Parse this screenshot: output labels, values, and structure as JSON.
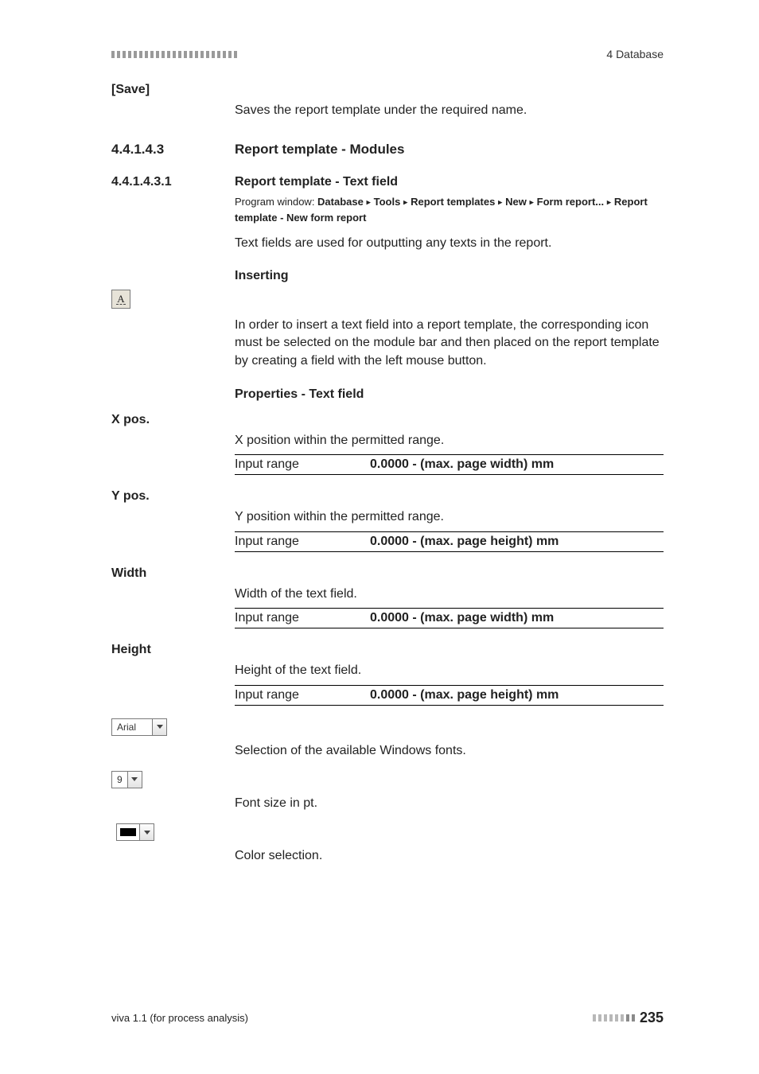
{
  "header": {
    "right": "4 Database"
  },
  "save": {
    "label": "[Save]",
    "desc": "Saves the report template under the required name."
  },
  "sec1": {
    "num": "4.4.1.4.3",
    "title": "Report template - Modules"
  },
  "sec2": {
    "num": "4.4.1.4.3.1",
    "title": "Report template - Text field",
    "crumb_prefix": "Program window: ",
    "crumb1": "Database",
    "crumb2": "Tools",
    "crumb3": "Report templates",
    "crumb4": "New",
    "crumb5": "Form report...",
    "crumb6": "Report template - New form report",
    "desc": "Text fields are used for outputting any texts in the report."
  },
  "inserting": {
    "title": "Inserting",
    "desc": "In order to insert a text field into a report template, the corresponding icon must be selected on the module bar and then placed on the report template by creating a field with the left mouse button."
  },
  "props": {
    "title": "Properties - Text field"
  },
  "xpos": {
    "label": "X pos.",
    "desc": "X position within the permitted range.",
    "range_label": "Input range",
    "range_value": "0.0000 - (max. page width) mm"
  },
  "ypos": {
    "label": "Y pos.",
    "desc": "Y position within the permitted range.",
    "range_label": "Input range",
    "range_value": "0.0000 - (max. page height) mm"
  },
  "width": {
    "label": "Width",
    "desc": "Width of the text field.",
    "range_label": "Input range",
    "range_value": "0.0000 - (max. page width) mm"
  },
  "height": {
    "label": "Height",
    "desc": "Height of the text field.",
    "range_label": "Input range",
    "range_value": "0.0000 - (max. page height) mm"
  },
  "font": {
    "value": "Arial",
    "desc": "Selection of the available Windows fonts."
  },
  "fontsize": {
    "value": "9",
    "desc": "Font size in pt."
  },
  "color": {
    "desc": "Color selection."
  },
  "footer": {
    "left": "viva 1.1 (for process analysis)",
    "page": "235"
  }
}
